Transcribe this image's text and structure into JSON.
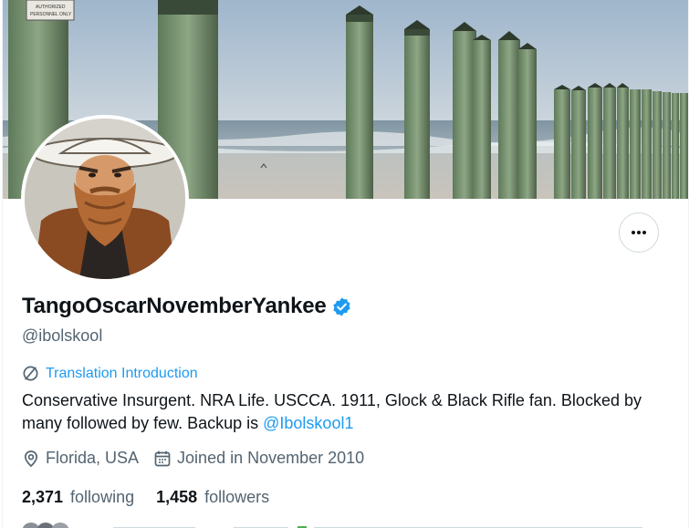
{
  "profile": {
    "display_name": "TangoOscarNovemberYankee",
    "handle": "@ibolskool",
    "translate_label": "Translation Introduction",
    "bio_text": "Conservative Insurgent. NRA Life. USCCA. 1911, Glock & Black Rifle fan. Blocked by many followed by few. Backup is ",
    "bio_link": "@Ibolskool1",
    "location": "Florida, USA",
    "joined": "Joined in November 2010",
    "following_count": "2,371",
    "following_label": "following",
    "followers_count": "1,458",
    "followers_label": "followers",
    "verified": true
  },
  "banner": {
    "sign_text_1": "AUTHORIZED",
    "sign_text_2": "PERSONNEL ONLY"
  },
  "icons": {
    "more": "more-horizontal-icon",
    "verified": "verified-badge-icon",
    "translate": "translate-icon",
    "location": "location-pin-icon",
    "calendar": "calendar-icon"
  },
  "colors": {
    "accent": "#1d9bf0",
    "secondary_text": "#536471",
    "primary_text": "#0f1419"
  }
}
